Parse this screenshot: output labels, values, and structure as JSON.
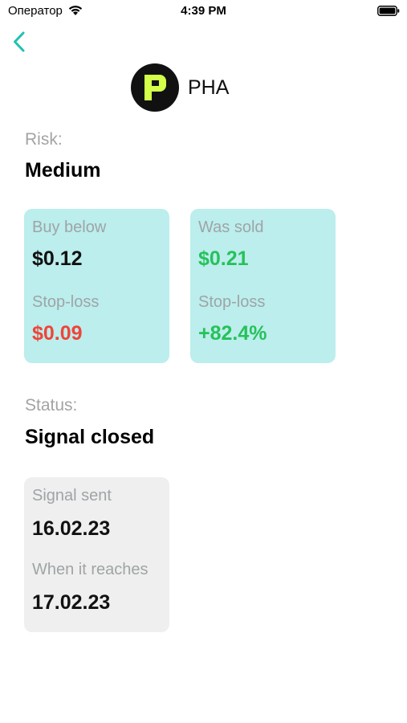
{
  "status_bar": {
    "carrier": "Оператор",
    "time": "4:39 PM"
  },
  "token": {
    "symbol": "PHA",
    "logo_letter": "P"
  },
  "risk": {
    "label": "Risk:",
    "value": "Medium"
  },
  "entry_card": {
    "buy_label": "Buy below",
    "buy_value": "$0.12",
    "stop_label": "Stop-loss",
    "stop_value": "$0.09"
  },
  "result_card": {
    "sold_label": "Was sold",
    "sold_value": "$0.21",
    "stop_label": "Stop-loss",
    "change_value": "+82.4%"
  },
  "status": {
    "label": "Status:",
    "value": "Signal closed"
  },
  "dates_card": {
    "sent_label": "Signal sent",
    "sent_value": "16.02.23",
    "reach_label": "When it reaches",
    "reach_value": "17.02.23"
  },
  "colors": {
    "accent_teal": "#1ec2b0",
    "card_teal": "#bbeeed",
    "card_gray": "#efefef",
    "loss_red": "#f04438",
    "gain_green": "#27c15a"
  },
  "icons": [
    "wifi-icon",
    "battery-icon",
    "back-chevron-icon",
    "pha-logo-icon"
  ]
}
